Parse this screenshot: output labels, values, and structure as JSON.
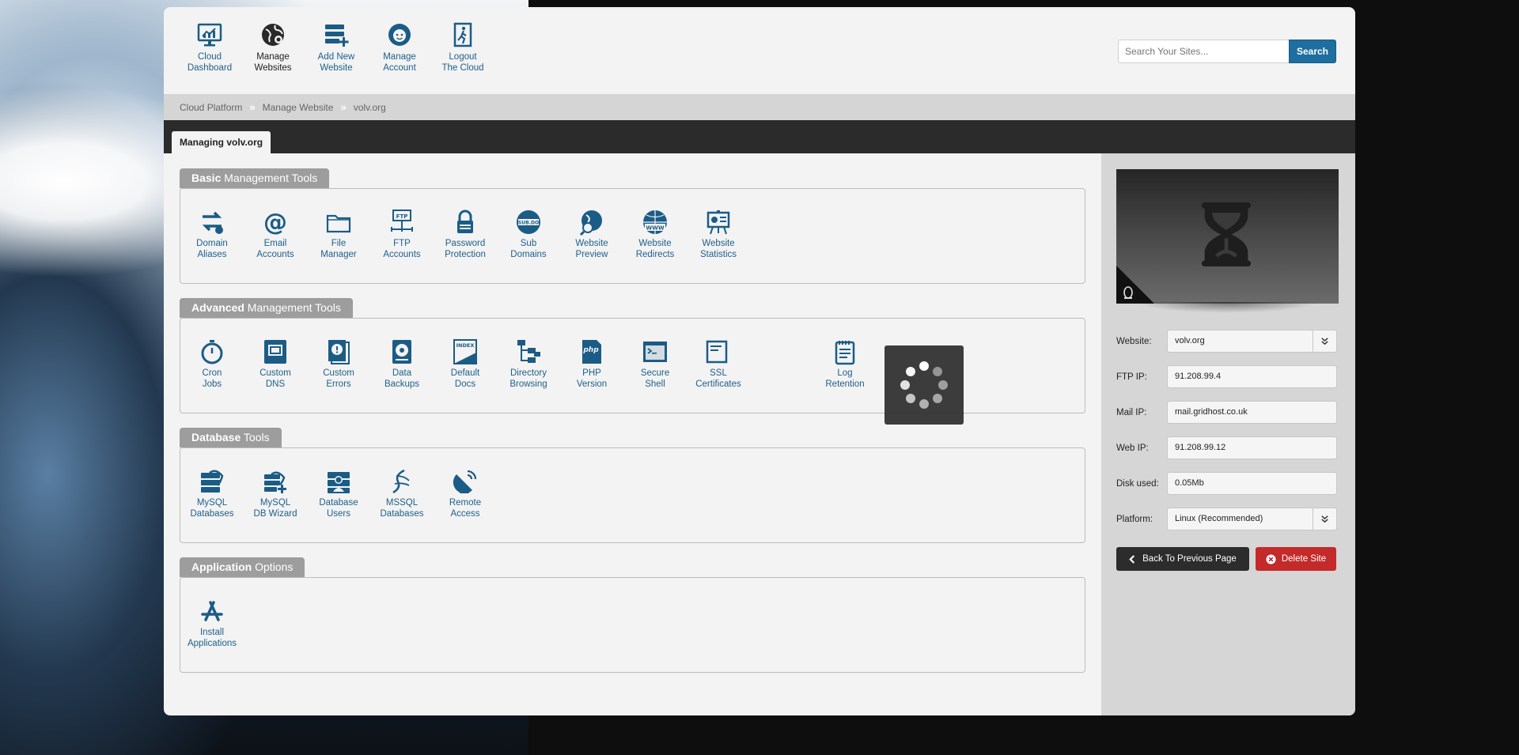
{
  "nav": {
    "items": [
      {
        "label": "Cloud\nDashboard",
        "icon": "monitor-chart-icon"
      },
      {
        "label": "Manage\nWebsites",
        "icon": "globe-gear-icon"
      },
      {
        "label": "Add New\nWebsite",
        "icon": "server-add-icon"
      },
      {
        "label": "Manage\nAccount",
        "icon": "user-icon"
      },
      {
        "label": "Logout\nThe Cloud",
        "icon": "exit-door-icon"
      }
    ]
  },
  "search": {
    "placeholder": "Search Your Sites...",
    "button": "Search"
  },
  "breadcrumb": {
    "items": [
      "Cloud Platform",
      "Manage Website",
      "volv.org"
    ],
    "separator": "»"
  },
  "managing_tab": "Managing volv.org",
  "sections": {
    "basic": {
      "title_bold": "Basic",
      "title_rest": " Management Tools",
      "tools": [
        {
          "label": "Domain\nAliases"
        },
        {
          "label": "Email\nAccounts"
        },
        {
          "label": "File\nManager"
        },
        {
          "label": "FTP\nAccounts"
        },
        {
          "label": "Password\nProtection"
        },
        {
          "label": "Sub\nDomains"
        },
        {
          "label": "Website\nPreview"
        },
        {
          "label": "Website\nRedirects"
        },
        {
          "label": "Website\nStatistics"
        }
      ]
    },
    "advanced": {
      "title_bold": "Advanced",
      "title_rest": " Management Tools",
      "tools": [
        {
          "label": "Cron\nJobs"
        },
        {
          "label": "Custom\nDNS"
        },
        {
          "label": "Custom\nErrors"
        },
        {
          "label": "Data\nBackups"
        },
        {
          "label": "Default\nDocs"
        },
        {
          "label": "Directory\nBrowsing"
        },
        {
          "label": "PHP\nVersion"
        },
        {
          "label": "Secure\nShell"
        },
        {
          "label": "SSL\nCertificates"
        },
        {
          "label": ""
        },
        {
          "label": "Log\nRetention"
        }
      ]
    },
    "database": {
      "title_bold": "Database",
      "title_rest": " Tools",
      "tools": [
        {
          "label": "MySQL\nDatabases"
        },
        {
          "label": "MySQL\nDB Wizard"
        },
        {
          "label": "Database\nUsers"
        },
        {
          "label": "MSSQL\nDatabases"
        },
        {
          "label": "Remote\nAccess"
        }
      ]
    },
    "application": {
      "title_bold": "Application",
      "title_rest": " Options",
      "tools": [
        {
          "label": "Install\nApplications"
        }
      ]
    }
  },
  "panel": {
    "website_label": "Website:",
    "website_value": "volv.org",
    "ftp_label": "FTP IP:",
    "ftp_value": "91.208.99.4",
    "mail_label": "Mail IP:",
    "mail_value": "mail.gridhost.co.uk",
    "web_label": "Web IP:",
    "web_value": "91.208.99.12",
    "disk_label": "Disk used:",
    "disk_value": "0.05Mb",
    "platform_label": "Platform:",
    "platform_value": "Linux (Recommended)",
    "back_button": "Back To Previous Page",
    "delete_button": "Delete Site"
  },
  "colors": {
    "accent": "#1e6ea0",
    "icon": "#1b5c86",
    "danger": "#c42a2a",
    "dark": "#2b2b2b"
  }
}
